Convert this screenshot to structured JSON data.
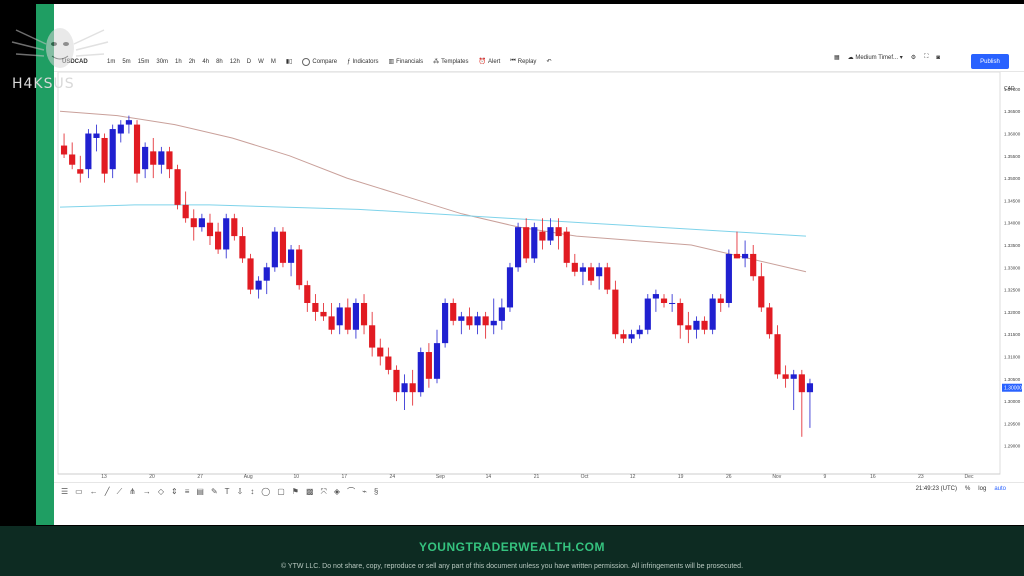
{
  "watermark": {
    "text": "H4KSUS",
    "icon": "anonymous-mask-icon"
  },
  "toolbar": {
    "symbol": "USDCAD",
    "timeframes": [
      "1m",
      "5m",
      "15m",
      "30m",
      "1h",
      "2h",
      "4h",
      "8h",
      "12h",
      "D",
      "W",
      "M"
    ],
    "compare": "Compare",
    "indicators": "Indicators",
    "financials": "Financials",
    "templates": "Templates",
    "alert": "Alert",
    "replay": "Replay",
    "layout_name": "Medium Timef...",
    "publish": "Publish"
  },
  "chart": {
    "currency": "CAD",
    "price_ticks": [
      "1.37000",
      "1.36500",
      "1.36000",
      "1.35500",
      "1.35000",
      "1.34500",
      "1.34000",
      "1.33500",
      "1.33000",
      "1.32500",
      "1.32000",
      "1.31500",
      "1.31000",
      "1.30500",
      "1.30000",
      "1.29500",
      "1.29000"
    ],
    "time_labels": [
      "13",
      "20",
      "27",
      "Aug",
      "10",
      "17",
      "24",
      "Sep",
      "14",
      "21",
      "Oct",
      "12",
      "19",
      "26",
      "Nov",
      "9",
      "16",
      "23",
      "Dec"
    ],
    "price_marker": "1.30000",
    "colors": {
      "up": "#2020d0",
      "down": "#e11b22",
      "ma_slow": "#c9a09a",
      "ma_fast": "#7fd3ea"
    }
  },
  "chart_data": {
    "type": "candlestick",
    "ylim": [
      1.285,
      1.372
    ],
    "candles": [
      {
        "o": 1.3573,
        "h": 1.36,
        "l": 1.3545,
        "c": 1.3553
      },
      {
        "o": 1.3553,
        "h": 1.358,
        "l": 1.352,
        "c": 1.353
      },
      {
        "o": 1.352,
        "h": 1.355,
        "l": 1.349,
        "c": 1.351
      },
      {
        "o": 1.352,
        "h": 1.361,
        "l": 1.35,
        "c": 1.36
      },
      {
        "o": 1.359,
        "h": 1.362,
        "l": 1.356,
        "c": 1.36
      },
      {
        "o": 1.359,
        "h": 1.36,
        "l": 1.349,
        "c": 1.351
      },
      {
        "o": 1.352,
        "h": 1.362,
        "l": 1.35,
        "c": 1.361
      },
      {
        "o": 1.36,
        "h": 1.363,
        "l": 1.358,
        "c": 1.362
      },
      {
        "o": 1.362,
        "h": 1.364,
        "l": 1.36,
        "c": 1.363
      },
      {
        "o": 1.362,
        "h": 1.363,
        "l": 1.349,
        "c": 1.351
      },
      {
        "o": 1.352,
        "h": 1.358,
        "l": 1.35,
        "c": 1.357
      },
      {
        "o": 1.356,
        "h": 1.359,
        "l": 1.35,
        "c": 1.353
      },
      {
        "o": 1.353,
        "h": 1.357,
        "l": 1.351,
        "c": 1.356
      },
      {
        "o": 1.356,
        "h": 1.357,
        "l": 1.35,
        "c": 1.352
      },
      {
        "o": 1.352,
        "h": 1.353,
        "l": 1.343,
        "c": 1.344
      },
      {
        "o": 1.344,
        "h": 1.347,
        "l": 1.34,
        "c": 1.341
      },
      {
        "o": 1.341,
        "h": 1.343,
        "l": 1.336,
        "c": 1.339
      },
      {
        "o": 1.339,
        "h": 1.342,
        "l": 1.338,
        "c": 1.341
      },
      {
        "o": 1.34,
        "h": 1.342,
        "l": 1.335,
        "c": 1.337
      },
      {
        "o": 1.338,
        "h": 1.34,
        "l": 1.333,
        "c": 1.334
      },
      {
        "o": 1.334,
        "h": 1.342,
        "l": 1.332,
        "c": 1.341
      },
      {
        "o": 1.341,
        "h": 1.342,
        "l": 1.336,
        "c": 1.337
      },
      {
        "o": 1.337,
        "h": 1.339,
        "l": 1.331,
        "c": 1.332
      },
      {
        "o": 1.332,
        "h": 1.333,
        "l": 1.324,
        "c": 1.325
      },
      {
        "o": 1.325,
        "h": 1.328,
        "l": 1.323,
        "c": 1.327
      },
      {
        "o": 1.327,
        "h": 1.331,
        "l": 1.324,
        "c": 1.33
      },
      {
        "o": 1.33,
        "h": 1.339,
        "l": 1.329,
        "c": 1.338
      },
      {
        "o": 1.338,
        "h": 1.339,
        "l": 1.33,
        "c": 1.331
      },
      {
        "o": 1.331,
        "h": 1.335,
        "l": 1.328,
        "c": 1.334
      },
      {
        "o": 1.334,
        "h": 1.335,
        "l": 1.325,
        "c": 1.326
      },
      {
        "o": 1.326,
        "h": 1.327,
        "l": 1.32,
        "c": 1.322
      },
      {
        "o": 1.322,
        "h": 1.324,
        "l": 1.318,
        "c": 1.32
      },
      {
        "o": 1.32,
        "h": 1.322,
        "l": 1.318,
        "c": 1.319
      },
      {
        "o": 1.319,
        "h": 1.322,
        "l": 1.315,
        "c": 1.316
      },
      {
        "o": 1.317,
        "h": 1.322,
        "l": 1.315,
        "c": 1.321
      },
      {
        "o": 1.321,
        "h": 1.323,
        "l": 1.315,
        "c": 1.316
      },
      {
        "o": 1.316,
        "h": 1.323,
        "l": 1.314,
        "c": 1.322
      },
      {
        "o": 1.322,
        "h": 1.324,
        "l": 1.315,
        "c": 1.317
      },
      {
        "o": 1.317,
        "h": 1.32,
        "l": 1.31,
        "c": 1.312
      },
      {
        "o": 1.312,
        "h": 1.314,
        "l": 1.308,
        "c": 1.31
      },
      {
        "o": 1.31,
        "h": 1.312,
        "l": 1.306,
        "c": 1.307
      },
      {
        "o": 1.307,
        "h": 1.308,
        "l": 1.3,
        "c": 1.302
      },
      {
        "o": 1.302,
        "h": 1.306,
        "l": 1.298,
        "c": 1.304
      },
      {
        "o": 1.304,
        "h": 1.307,
        "l": 1.299,
        "c": 1.302
      },
      {
        "o": 1.302,
        "h": 1.312,
        "l": 1.301,
        "c": 1.311
      },
      {
        "o": 1.311,
        "h": 1.313,
        "l": 1.303,
        "c": 1.305
      },
      {
        "o": 1.305,
        "h": 1.316,
        "l": 1.304,
        "c": 1.313
      },
      {
        "o": 1.313,
        "h": 1.323,
        "l": 1.312,
        "c": 1.322
      },
      {
        "o": 1.322,
        "h": 1.323,
        "l": 1.317,
        "c": 1.318
      },
      {
        "o": 1.318,
        "h": 1.32,
        "l": 1.315,
        "c": 1.319
      },
      {
        "o": 1.319,
        "h": 1.321,
        "l": 1.316,
        "c": 1.317
      },
      {
        "o": 1.317,
        "h": 1.32,
        "l": 1.315,
        "c": 1.319
      },
      {
        "o": 1.319,
        "h": 1.32,
        "l": 1.314,
        "c": 1.317
      },
      {
        "o": 1.317,
        "h": 1.323,
        "l": 1.315,
        "c": 1.318
      },
      {
        "o": 1.318,
        "h": 1.323,
        "l": 1.316,
        "c": 1.321
      },
      {
        "o": 1.321,
        "h": 1.331,
        "l": 1.32,
        "c": 1.33
      },
      {
        "o": 1.33,
        "h": 1.34,
        "l": 1.329,
        "c": 1.339
      },
      {
        "o": 1.339,
        "h": 1.341,
        "l": 1.331,
        "c": 1.332
      },
      {
        "o": 1.332,
        "h": 1.34,
        "l": 1.331,
        "c": 1.339
      },
      {
        "o": 1.338,
        "h": 1.341,
        "l": 1.334,
        "c": 1.336
      },
      {
        "o": 1.336,
        "h": 1.341,
        "l": 1.335,
        "c": 1.339
      },
      {
        "o": 1.339,
        "h": 1.341,
        "l": 1.334,
        "c": 1.337
      },
      {
        "o": 1.338,
        "h": 1.339,
        "l": 1.33,
        "c": 1.331
      },
      {
        "o": 1.331,
        "h": 1.333,
        "l": 1.328,
        "c": 1.329
      },
      {
        "o": 1.329,
        "h": 1.331,
        "l": 1.326,
        "c": 1.33
      },
      {
        "o": 1.33,
        "h": 1.331,
        "l": 1.326,
        "c": 1.327
      },
      {
        "o": 1.328,
        "h": 1.331,
        "l": 1.325,
        "c": 1.33
      },
      {
        "o": 1.33,
        "h": 1.331,
        "l": 1.324,
        "c": 1.325
      },
      {
        "o": 1.325,
        "h": 1.327,
        "l": 1.314,
        "c": 1.315
      },
      {
        "o": 1.315,
        "h": 1.316,
        "l": 1.313,
        "c": 1.314
      },
      {
        "o": 1.314,
        "h": 1.316,
        "l": 1.313,
        "c": 1.315
      },
      {
        "o": 1.315,
        "h": 1.317,
        "l": 1.314,
        "c": 1.316
      },
      {
        "o": 1.316,
        "h": 1.324,
        "l": 1.315,
        "c": 1.323
      },
      {
        "o": 1.323,
        "h": 1.325,
        "l": 1.32,
        "c": 1.324
      },
      {
        "o": 1.323,
        "h": 1.324,
        "l": 1.321,
        "c": 1.322
      },
      {
        "o": 1.322,
        "h": 1.324,
        "l": 1.32,
        "c": 1.322
      },
      {
        "o": 1.322,
        "h": 1.323,
        "l": 1.314,
        "c": 1.317
      },
      {
        "o": 1.317,
        "h": 1.32,
        "l": 1.313,
        "c": 1.316
      },
      {
        "o": 1.316,
        "h": 1.319,
        "l": 1.314,
        "c": 1.318
      },
      {
        "o": 1.318,
        "h": 1.319,
        "l": 1.315,
        "c": 1.316
      },
      {
        "o": 1.316,
        "h": 1.324,
        "l": 1.315,
        "c": 1.323
      },
      {
        "o": 1.323,
        "h": 1.324,
        "l": 1.32,
        "c": 1.322
      },
      {
        "o": 1.322,
        "h": 1.334,
        "l": 1.321,
        "c": 1.333
      },
      {
        "o": 1.333,
        "h": 1.338,
        "l": 1.332,
        "c": 1.332
      },
      {
        "o": 1.332,
        "h": 1.336,
        "l": 1.33,
        "c": 1.333
      },
      {
        "o": 1.333,
        "h": 1.335,
        "l": 1.327,
        "c": 1.328
      },
      {
        "o": 1.328,
        "h": 1.331,
        "l": 1.32,
        "c": 1.321
      },
      {
        "o": 1.321,
        "h": 1.322,
        "l": 1.314,
        "c": 1.315
      },
      {
        "o": 1.315,
        "h": 1.317,
        "l": 1.305,
        "c": 1.306
      },
      {
        "o": 1.306,
        "h": 1.308,
        "l": 1.303,
        "c": 1.305
      },
      {
        "o": 1.305,
        "h": 1.307,
        "l": 1.298,
        "c": 1.306
      },
      {
        "o": 1.306,
        "h": 1.307,
        "l": 1.292,
        "c": 1.302
      },
      {
        "o": 1.302,
        "h": 1.305,
        "l": 1.294,
        "c": 1.304
      }
    ],
    "ma_slow": [
      1.365,
      1.364,
      1.362,
      1.359,
      1.355,
      1.35,
      1.346,
      1.342,
      1.339,
      1.337,
      1.336,
      1.335,
      1.332,
      1.329
    ],
    "ma_fast": [
      1.3435,
      1.344,
      1.344,
      1.3435,
      1.343,
      1.342,
      1.341,
      1.34,
      1.339,
      1.338,
      1.337
    ],
    "price_marker_value": 1.303
  },
  "bottom": {
    "time": "21:49:23 (UTC)",
    "pct": "%",
    "log": "log",
    "auto": "auto"
  },
  "footer": {
    "site": "YOUNGTRADERWEALTH.COM",
    "copyright": "© YTW LLC. Do not share, copy, reproduce or sell any part of this document unless you have written permission. All infringements will be prosecuted."
  }
}
